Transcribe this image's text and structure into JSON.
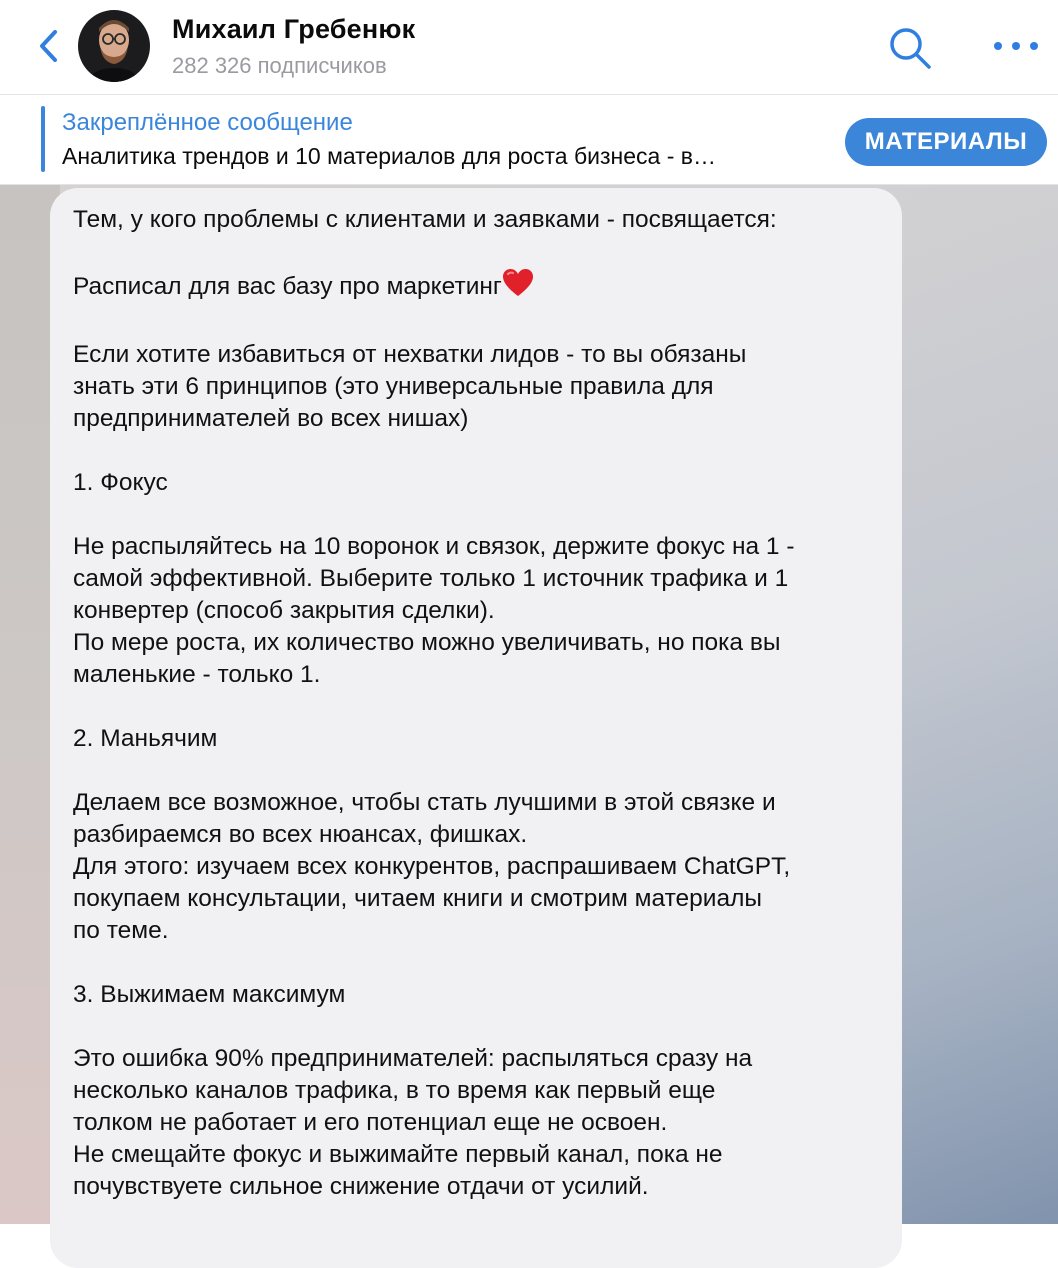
{
  "header": {
    "title": "Михаил Гребенюк",
    "subtitle": "282 326 подписчиков",
    "accent_color": "#2f7fe0"
  },
  "pinned": {
    "title": "Закреплённое сообщение",
    "text": "Аналитика трендов и 10 материалов для роста бизнеса - в…",
    "button_label": "МАТЕРИАЛЫ"
  },
  "message": {
    "lines": [
      "Тем, у кого проблемы с клиентами и заявками - посвящается:",
      "",
      "Расписал для вас базу про маркетинг",
      "",
      "Если хотите избавиться от нехватки лидов - то вы обязаны",
      "знать эти 6 принципов (это универсальные правила для",
      "предпринимателей во всех нишах)",
      "",
      "1. Фокус",
      "",
      "Не распыляйтесь на 10 воронок и связок, держите фокус на 1 -",
      "самой эффективной. Выберите только 1 источник трафика и 1",
      "конвертер (способ закрытия сделки).",
      "По мере роста, их количество можно увеличивать, но пока вы",
      "маленькие - только 1.",
      "",
      "2. Маньячим",
      "",
      "Делаем все возможное, чтобы стать лучшими в этой связке и",
      "разбираемся во всех нюансах, фишках.",
      "Для этого: изучаем всех конкурентов, распрашиваем ChatGPT,",
      "покупаем консультации, читаем книги и смотрим материалы",
      "по теме.",
      "",
      "3. Выжимаем максимум",
      "",
      "Это ошибка 90% предпринимателей: распыляться сразу на",
      "несколько каналов трафика, в то время как первый еще",
      "толком не работает и его потенциал еще не освоен.",
      "Не смещайте фокус и выжимайте первый канал, пока не",
      "почувствуете сильное снижение отдачи от усилий."
    ]
  }
}
